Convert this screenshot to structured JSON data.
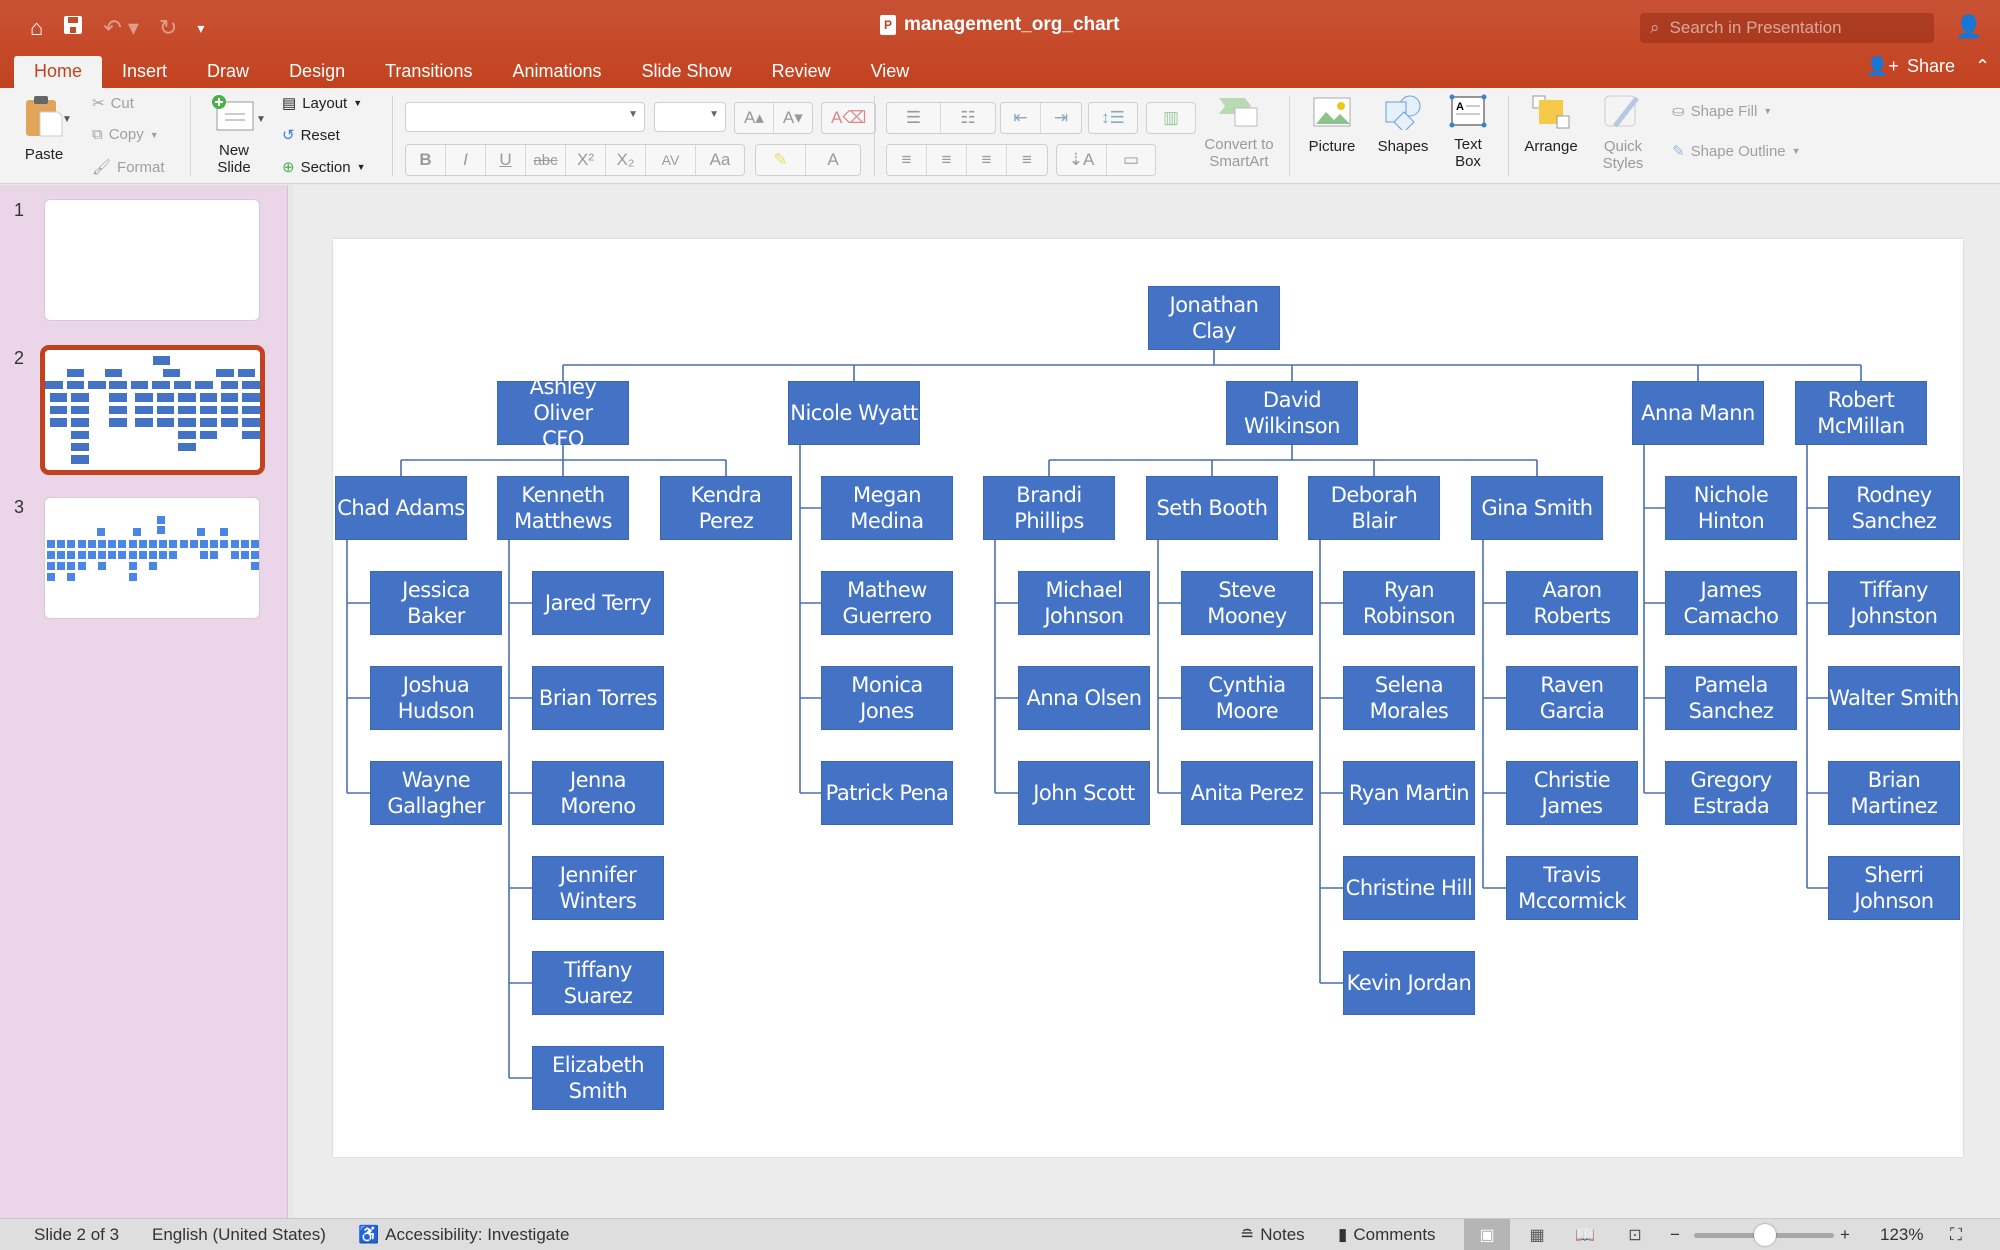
{
  "window": {
    "title": "management_org_chart",
    "search_placeholder": "Search in Presentation",
    "share_label": "Share"
  },
  "quick_access": {
    "icons": [
      "home-icon",
      "save-icon",
      "undo-icon",
      "redo-icon",
      "customize-icon"
    ]
  },
  "tabs": [
    {
      "label": "Home",
      "active": true
    },
    {
      "label": "Insert"
    },
    {
      "label": "Draw"
    },
    {
      "label": "Design"
    },
    {
      "label": "Transitions"
    },
    {
      "label": "Animations"
    },
    {
      "label": "Slide Show"
    },
    {
      "label": "Review"
    },
    {
      "label": "View"
    }
  ],
  "ribbon": {
    "paste": "Paste",
    "cut": "Cut",
    "copy": "Copy",
    "format": "Format",
    "new_slide": [
      "New",
      "Slide"
    ],
    "layout": "Layout",
    "reset": "Reset",
    "section": "Section",
    "font_name": "",
    "font_size": "",
    "format_buttons": [
      "B",
      "I",
      "U",
      "abc",
      "X²",
      "X₂",
      "AV",
      "Aa"
    ],
    "convert_smartart": [
      "Convert to",
      "SmartArt"
    ],
    "picture": "Picture",
    "shapes": "Shapes",
    "text_box": [
      "Text",
      "Box"
    ],
    "arrange": "Arrange",
    "quick_styles": [
      "Quick",
      "Styles"
    ],
    "shape_fill": "Shape Fill",
    "shape_outline": "Shape Outline"
  },
  "slides": [
    {
      "number": "1",
      "selected": false
    },
    {
      "number": "2",
      "selected": true
    },
    {
      "number": "3",
      "selected": false
    }
  ],
  "colors": {
    "accent": "#c2421f",
    "node_fill": "#4472c4",
    "connector": "#4a6fb0"
  },
  "org_chart": {
    "root": "Jonathan\nClay",
    "managers": [
      {
        "name": "Ashley Oliver\nCFO",
        "leads": [
          {
            "name": "Chad Adams",
            "reports": [
              "Jessica Baker",
              "Joshua\nHudson",
              "Wayne\nGallagher"
            ]
          },
          {
            "name": "Kenneth\nMatthews",
            "reports": [
              "Jared Terry",
              "Brian Torres",
              "Jenna\nMoreno",
              "Jennifer\nWinters",
              "Tiffany\nSuarez",
              "Elizabeth\nSmith"
            ]
          },
          {
            "name": "Kendra Perez",
            "reports": []
          }
        ]
      },
      {
        "name": "Nicole Wyatt",
        "reports": [
          "Megan\nMedina",
          "Mathew\nGuerrero",
          "Monica Jones",
          "Patrick Pena"
        ]
      },
      {
        "name": "David\nWilkinson",
        "leads": [
          {
            "name": "Brandi\nPhillips",
            "reports": [
              "Michael\nJohnson",
              "Anna Olsen",
              "John Scott"
            ]
          },
          {
            "name": "Seth Booth",
            "reports": [
              "Steve\nMooney",
              "Cynthia\nMoore",
              "Anita Perez"
            ]
          },
          {
            "name": "Deborah\nBlair",
            "reports": [
              "Ryan\nRobinson",
              "Selena\nMorales",
              "Ryan Martin",
              "Christine Hill",
              "Kevin Jordan"
            ]
          },
          {
            "name": "Gina Smith",
            "reports": [
              "Aaron\nRoberts",
              "Raven Garcia",
              "Christie\nJames",
              "Travis\nMccormick"
            ]
          }
        ]
      },
      {
        "name": "Anna Mann",
        "reports": [
          "Nichole\nHinton",
          "James\nCamacho",
          "Pamela\nSanchez",
          "Gregory\nEstrada"
        ]
      },
      {
        "name": "Robert\nMcMillan",
        "reports": [
          "Rodney\nSanchez",
          "Tiffany\nJohnston",
          "Walter Smith",
          "Brian\nMartinez",
          "Sherri\nJohnson"
        ]
      }
    ]
  },
  "statusbar": {
    "slide_indicator": "Slide 2 of 3",
    "language": "English (United States)",
    "accessibility": "Accessibility: Investigate",
    "notes": "Notes",
    "comments": "Comments",
    "zoom": "123%",
    "zoom_level_percent": 123
  }
}
